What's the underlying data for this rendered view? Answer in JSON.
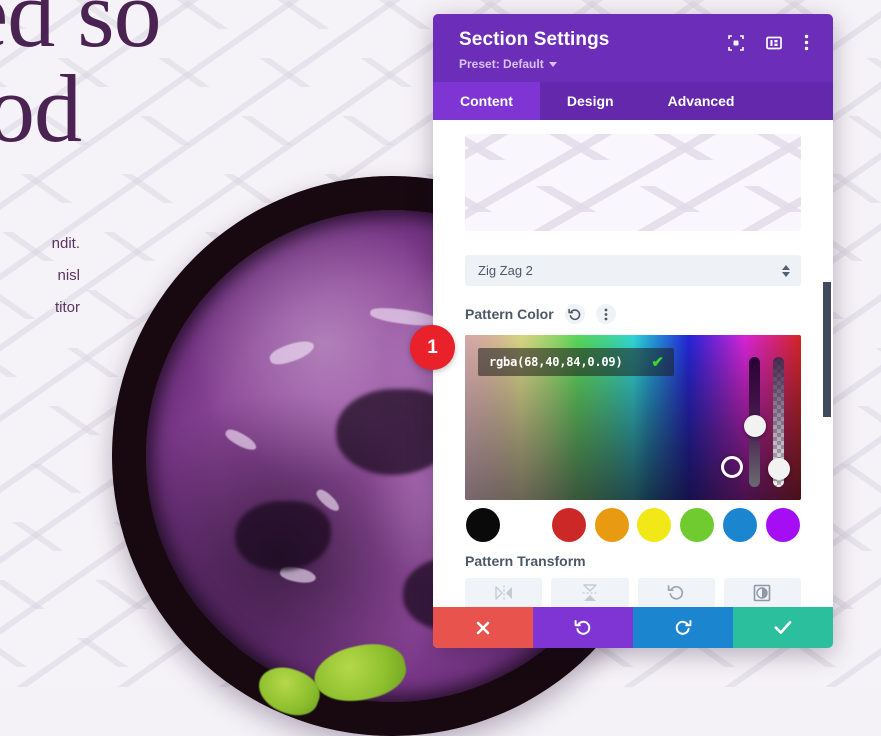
{
  "background_page": {
    "heading": "ted so\nood",
    "body_lines": [
      "ndit.",
      "nisl",
      "titor"
    ],
    "heading_color": "#4a2352",
    "pattern_name": "zigzag-chevron"
  },
  "step_marker": {
    "number": "1",
    "color": "#e8212b"
  },
  "modal": {
    "title": "Section Settings",
    "preset_label": "Preset: Default",
    "header_icons": [
      {
        "name": "focus-frame-icon",
        "glyph": "focus"
      },
      {
        "name": "layout-split-icon",
        "glyph": "layout"
      },
      {
        "name": "kebab-menu-icon",
        "glyph": "kebab"
      }
    ],
    "tabs": [
      {
        "label": "Content",
        "active": true
      },
      {
        "label": "Design",
        "active": false
      },
      {
        "label": "Advanced",
        "active": false
      }
    ],
    "accent_color": "#6c2eb9",
    "tabbar_color": "#6428ad",
    "active_tab_color": "#7e35d4"
  },
  "pattern_section": {
    "preview_name": "pattern-preview",
    "select": {
      "value": "Zig Zag 2",
      "icon": "stepper-arrows-icon"
    },
    "color_field": {
      "label": "Pattern Color",
      "reset_icon": "reset-arrow-icon",
      "more_icon": "kebab-menu-icon",
      "value": "rgba(68,40,84,0.09)",
      "confirm_icon": "check-icon",
      "confirm_color": "#3ad62e"
    },
    "swatches": [
      {
        "name": "swatch-black",
        "color": "#0a0a0a"
      },
      {
        "name": "swatch-white",
        "color": "#ffffff"
      },
      {
        "name": "swatch-red",
        "color": "#cc2828"
      },
      {
        "name": "swatch-orange",
        "color": "#e89a10"
      },
      {
        "name": "swatch-yellow",
        "color": "#f2e818"
      },
      {
        "name": "swatch-green",
        "color": "#6fcb30"
      },
      {
        "name": "swatch-blue",
        "color": "#1c85cf"
      },
      {
        "name": "swatch-purple",
        "color": "#a50df5"
      }
    ],
    "transform": {
      "label": "Pattern Transform",
      "buttons": [
        {
          "name": "flip-horizontal-button",
          "icon": "flip-horizontal-icon"
        },
        {
          "name": "flip-vertical-button",
          "icon": "flip-vertical-icon"
        },
        {
          "name": "rotate-button",
          "icon": "rotate-ccw-icon"
        },
        {
          "name": "invert-button",
          "icon": "invert-contrast-icon"
        }
      ]
    }
  },
  "footer": {
    "buttons": [
      {
        "name": "cancel-button",
        "icon": "close-x-icon",
        "color": "#e8544d"
      },
      {
        "name": "undo-button",
        "icon": "undo-arrow-icon",
        "color": "#7e35d4"
      },
      {
        "name": "redo-button",
        "icon": "redo-arrow-icon",
        "color": "#1c85cf"
      },
      {
        "name": "save-button",
        "icon": "check-icon",
        "color": "#2bbf9e"
      }
    ]
  }
}
